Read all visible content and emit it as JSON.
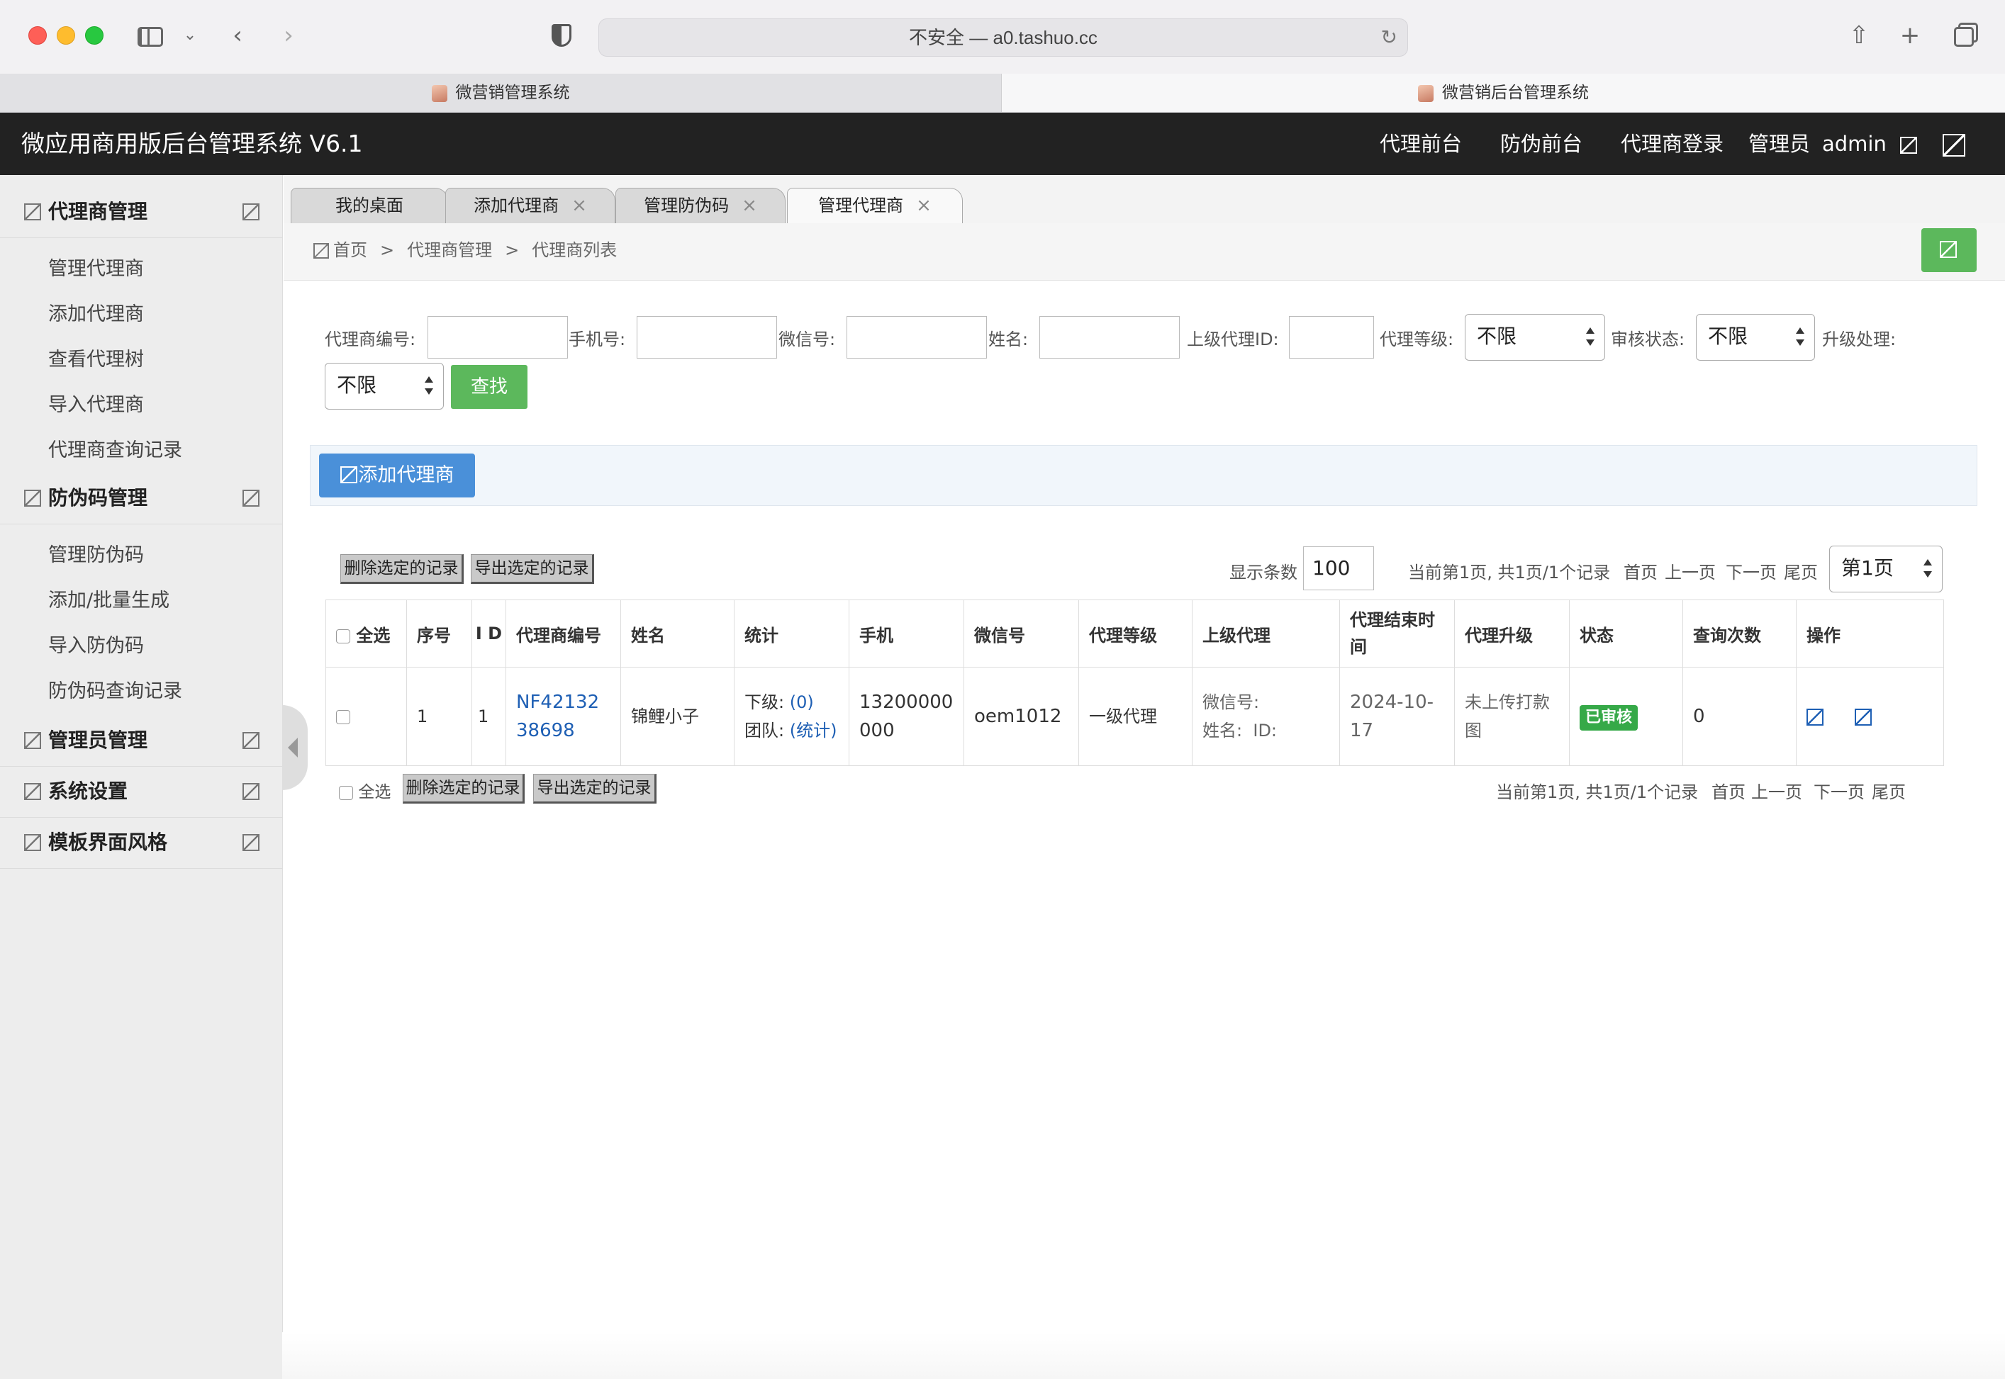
{
  "browser": {
    "url": "不安全 — a0.tashuo.cc",
    "tabs": [
      {
        "label": "微营销管理系统"
      },
      {
        "label": "微营销后台管理系统"
      }
    ]
  },
  "header": {
    "title": "微应用商用版后台管理系统 V6.1",
    "links": [
      "代理前台",
      "防伪前台",
      "代理商登录",
      "管理员",
      "admin"
    ]
  },
  "sidebar": {
    "groups": [
      {
        "label": "代理商管理",
        "items": [
          "管理代理商",
          "添加代理商",
          "查看代理树",
          "导入代理商",
          "代理商查询记录"
        ]
      },
      {
        "label": "防伪码管理",
        "items": [
          "管理防伪码",
          "添加/批量生成",
          "导入防伪码",
          "防伪码查询记录"
        ]
      },
      {
        "label": "管理员管理"
      },
      {
        "label": "系统设置"
      },
      {
        "label": "模板界面风格"
      }
    ]
  },
  "page_tabs": [
    "我的桌面",
    "添加代理商",
    "管理防伪码",
    "管理代理商"
  ],
  "breadcrumb": [
    "首页",
    "代理商管理",
    "代理商列表"
  ],
  "breadcrumb_sep": ">",
  "tab_close": "×",
  "filters": {
    "agent_no_label": "代理商编号:",
    "phone_label": "手机号:",
    "wechat_label": "微信号:",
    "name_label": "姓名:",
    "parent_id_label": "上级代理ID:",
    "level_label": "代理等级:",
    "level_value": "不限",
    "review_label": "审核状态:",
    "review_value": "不限",
    "upgrade_label": "升级处理:",
    "upgrade_value": "不限",
    "search_button": "查找"
  },
  "add_agent_button": "添加代理商",
  "toolbar": {
    "delete_selected": "删除选定的记录",
    "export_selected": "导出选定的记录",
    "page_size_label": "显示条数",
    "page_size": "100",
    "page_info": "当前第1页, 共1页/1个记录",
    "first": "首页",
    "prev": "上一页",
    "next": "下一页",
    "last": "尾页",
    "page_select": "第1页"
  },
  "table": {
    "headers": [
      "全选",
      "序号",
      "I D",
      "代理商编号",
      "姓名",
      "统计",
      "手机",
      "微信号",
      "代理等级",
      "上级代理",
      "代理结束时间",
      "代理升级",
      "状态",
      "查询次数",
      "操作"
    ],
    "rows": [
      {
        "seq": "1",
        "id": "1",
        "agent_no": "NF4213238698",
        "name": "锦鲤小子",
        "stat_sub_label": "下级:",
        "stat_sub_value": "(0)",
        "stat_team_label": "团队:",
        "stat_team_value": "(统计)",
        "phone": "13200000000",
        "wechat": "oem1012",
        "level": "一级代理",
        "parent_wechat_label": "微信号:",
        "parent_name_label": "姓名:",
        "parent_id_label": "ID:",
        "end_time": "2024-10-17",
        "upgrade": "未上传打款图",
        "status": "已审核",
        "query_count": "0"
      }
    ]
  },
  "footer": {
    "select_all": "全选",
    "delete_selected": "删除选定的记录",
    "export_selected": "导出选定的记录",
    "page_info": "当前第1页, 共1页/1个记录",
    "first": "首页",
    "prev": "上一页",
    "next": "下一页",
    "last": "尾页"
  },
  "colors": {
    "header_bg": "#222222",
    "green": "#5cb85c",
    "blue": "#4a90d9",
    "link_blue": "#1e5fb4",
    "badge_green": "#36a948"
  }
}
